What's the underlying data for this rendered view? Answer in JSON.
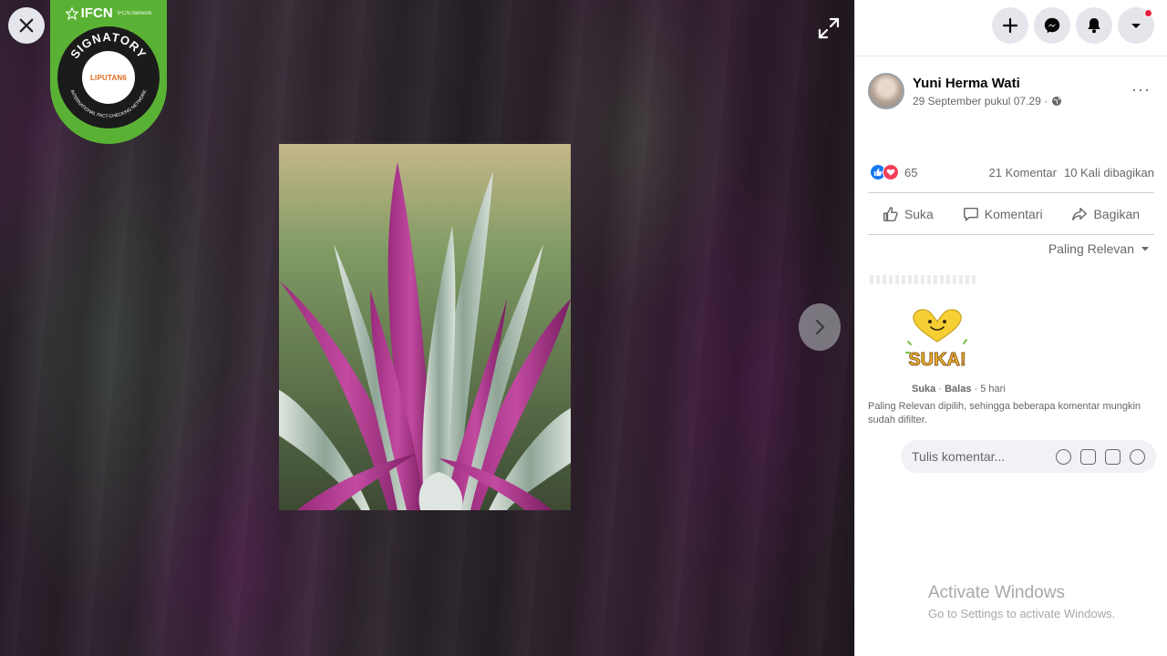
{
  "viewer": {
    "close_icon": "close-icon",
    "expand_icon": "fullscreen-icon",
    "next_icon": "chevron-right-icon"
  },
  "badge": {
    "brand": "IFCN",
    "brand_sub": "IFCN.Network",
    "ring_text": "SIGNATORY",
    "ring_text_bottom": "INTERNATIONAL FACT-CHECKING NETWORK",
    "inner_logo": "LIPUTAN6"
  },
  "topbar": {
    "icons": [
      "plus-icon",
      "messenger-icon",
      "bell-icon",
      "caret-down-icon"
    ]
  },
  "post": {
    "author": "Yuni Herma Wati",
    "time": "29 September pukul 07.29 ·",
    "privacy_icon": "globe-icon",
    "more_label": "···"
  },
  "stats": {
    "reactions_count": "65",
    "comments": "21 Komentar",
    "shares": "10 Kali dibagikan"
  },
  "actions": {
    "like": "Suka",
    "comment": "Komentari",
    "share": "Bagikan"
  },
  "sort": {
    "label": "Paling Relevan"
  },
  "comment": {
    "sticker_text": "SUKA!",
    "like": "Suka",
    "reply": "Balas",
    "age": "5 hari"
  },
  "relevan_note": "Paling Relevan dipilih, sehingga beberapa komentar mungkin sudah difilter.",
  "composer": {
    "placeholder": "Tulis komentar..."
  },
  "watermark": {
    "title": "Activate Windows",
    "subtitle": "Go to Settings to activate Windows."
  },
  "colors": {
    "fb_blue": "#1877f2",
    "love_red": "#f33e58",
    "ifcn_green": "#5ab234"
  }
}
